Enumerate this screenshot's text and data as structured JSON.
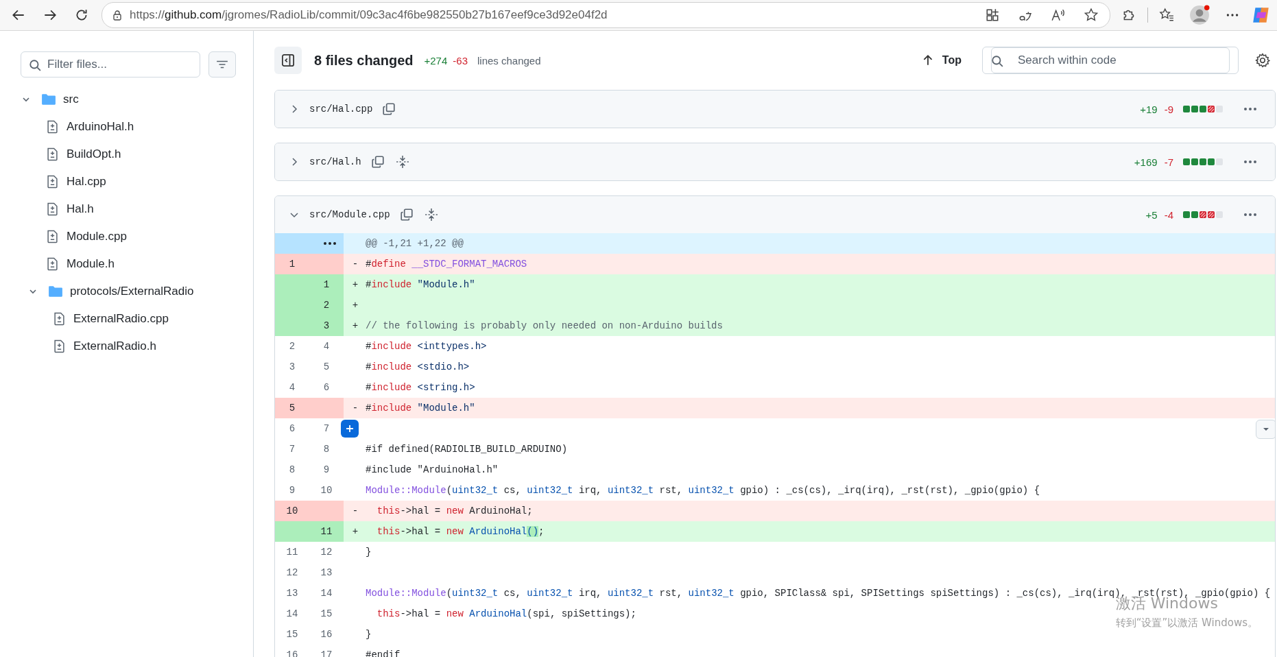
{
  "browser": {
    "url": {
      "scheme": "https://",
      "host": "github.com",
      "path": "/jgromes/RadioLib/commit/09c3ac4f6be982550b27b167eef9ce3d92e04f2d"
    }
  },
  "sidebar": {
    "filter": {
      "placeholder": "Filter files..."
    },
    "tree": [
      {
        "kind": "folder",
        "name": "src",
        "expanded": true,
        "children": [
          {
            "kind": "file",
            "name": "ArduinoHal.h"
          },
          {
            "kind": "file",
            "name": "BuildOpt.h"
          },
          {
            "kind": "file",
            "name": "Hal.cpp"
          },
          {
            "kind": "file",
            "name": "Hal.h"
          },
          {
            "kind": "file",
            "name": "Module.cpp"
          },
          {
            "kind": "file",
            "name": "Module.h"
          },
          {
            "kind": "folder",
            "name": "protocols/ExternalRadio",
            "expanded": true,
            "children": [
              {
                "kind": "file",
                "name": "ExternalRadio.cpp"
              },
              {
                "kind": "file",
                "name": "ExternalRadio.h"
              }
            ]
          }
        ]
      }
    ]
  },
  "summary": {
    "title": "8 files changed",
    "added": "+274",
    "deleted": "-63",
    "caption": "lines changed",
    "top_label": "Top",
    "search": {
      "placeholder": "Search within code"
    }
  },
  "files": [
    {
      "path": "src/Hal.cpp",
      "expanded": false,
      "expandable": false,
      "added": "+19",
      "deleted": "-9",
      "bar": [
        {
          "kind": "added"
        },
        {
          "kind": "added"
        },
        {
          "kind": "added"
        },
        {
          "kind": "deleted"
        },
        {
          "kind": "neutral"
        }
      ]
    },
    {
      "path": "src/Hal.h",
      "expanded": false,
      "expandable": true,
      "added": "+169",
      "deleted": "-7",
      "bar": [
        {
          "kind": "added"
        },
        {
          "kind": "added"
        },
        {
          "kind": "added"
        },
        {
          "kind": "added"
        },
        {
          "kind": "neutral"
        }
      ]
    },
    {
      "path": "src/Module.cpp",
      "expanded": true,
      "expandable": true,
      "added": "+5",
      "deleted": "-4",
      "bar": [
        {
          "kind": "added"
        },
        {
          "kind": "added"
        },
        {
          "kind": "deleted"
        },
        {
          "kind": "deleted"
        },
        {
          "kind": "neutral"
        }
      ],
      "lines": [
        {
          "kind": "hunk",
          "text": "@@ -1,21 +1,22 @@"
        },
        {
          "kind": "deleted",
          "old": "1",
          "sign": "-",
          "tokens": [
            {
              "text": "#",
              "kind": "plain"
            },
            {
              "text": "define",
              "kind": "keyword"
            },
            {
              "text": " __STDC_FORMAT_MACROS",
              "kind": "macro"
            }
          ]
        },
        {
          "kind": "added",
          "new": "1",
          "sign": "+",
          "tokens": [
            {
              "text": "#",
              "kind": "plain"
            },
            {
              "text": "include",
              "kind": "keyword"
            },
            {
              "text": " \"Module.h\"",
              "kind": "string"
            }
          ]
        },
        {
          "kind": "added",
          "new": "2",
          "sign": "+"
        },
        {
          "kind": "added",
          "new": "3",
          "sign": "+",
          "tokens": [
            {
              "text": "// the following is probably only needed on non-Arduino builds",
              "kind": "comment"
            }
          ]
        },
        {
          "kind": "context",
          "old": "2",
          "new": "4",
          "tokens": [
            {
              "text": "#",
              "kind": "plain"
            },
            {
              "text": "include",
              "kind": "keyword"
            },
            {
              "text": " <inttypes.h>",
              "kind": "string"
            }
          ]
        },
        {
          "kind": "context",
          "old": "3",
          "new": "5",
          "tokens": [
            {
              "text": "#",
              "kind": "plain"
            },
            {
              "text": "include",
              "kind": "keyword"
            },
            {
              "text": " <stdio.h>",
              "kind": "string"
            }
          ]
        },
        {
          "kind": "context",
          "old": "4",
          "new": "6",
          "tokens": [
            {
              "text": "#",
              "kind": "plain"
            },
            {
              "text": "include",
              "kind": "keyword"
            },
            {
              "text": " <string.h>",
              "kind": "string"
            }
          ]
        },
        {
          "kind": "deleted",
          "old": "5",
          "sign": "-",
          "tokens": [
            {
              "text": "#",
              "kind": "plain"
            },
            {
              "text": "include",
              "kind": "keyword"
            },
            {
              "text": " \"Module.h\"",
              "kind": "string"
            }
          ]
        },
        {
          "kind": "context",
          "old": "6",
          "new": "7",
          "hovered": true
        },
        {
          "kind": "context",
          "old": "7",
          "new": "8",
          "tokens": [
            {
              "text": "#if defined(RADIOLIB_BUILD_ARDUINO)",
              "kind": "plain"
            }
          ]
        },
        {
          "kind": "context",
          "old": "8",
          "new": "9",
          "tokens": [
            {
              "text": "#include \"ArduinoHal.h\"",
              "kind": "plain"
            }
          ]
        },
        {
          "kind": "context",
          "old": "9",
          "new": "10",
          "tokens": [
            {
              "text": "Module::Module",
              "kind": "macro"
            },
            {
              "text": "(",
              "kind": "plain"
            },
            {
              "text": "uint32_t",
              "kind": "type"
            },
            {
              "text": " cs, ",
              "kind": "plain"
            },
            {
              "text": "uint32_t",
              "kind": "type"
            },
            {
              "text": " irq, ",
              "kind": "plain"
            },
            {
              "text": "uint32_t",
              "kind": "type"
            },
            {
              "text": " rst, ",
              "kind": "plain"
            },
            {
              "text": "uint32_t",
              "kind": "type"
            },
            {
              "text": " gpio) : _cs(cs), _irq(irq), _rst(rst), _gpio(gpio) {",
              "kind": "plain"
            }
          ]
        },
        {
          "kind": "deleted",
          "old": "10",
          "sign": "-",
          "tokens": [
            {
              "text": "  this",
              "kind": "keyword"
            },
            {
              "text": "->hal = ",
              "kind": "plain"
            },
            {
              "text": "new",
              "kind": "keyword"
            },
            {
              "text": " ArduinoHal;",
              "kind": "plain"
            }
          ]
        },
        {
          "kind": "added",
          "new": "11",
          "sign": "+",
          "tokens": [
            {
              "text": "  this",
              "kind": "keyword"
            },
            {
              "text": "->hal = ",
              "kind": "plain"
            },
            {
              "text": "new",
              "kind": "keyword"
            },
            {
              "text": " ArduinoHal",
              "kind": "type"
            },
            {
              "text": "()",
              "kind": "changed"
            },
            {
              "text": ";",
              "kind": "plain"
            }
          ]
        },
        {
          "kind": "context",
          "old": "11",
          "new": "12",
          "tokens": [
            {
              "text": "}",
              "kind": "plain"
            }
          ]
        },
        {
          "kind": "context",
          "old": "12",
          "new": "13"
        },
        {
          "kind": "context",
          "old": "13",
          "new": "14",
          "tokens": [
            {
              "text": "Module::Module",
              "kind": "macro"
            },
            {
              "text": "(",
              "kind": "plain"
            },
            {
              "text": "uint32_t",
              "kind": "type"
            },
            {
              "text": " cs, ",
              "kind": "plain"
            },
            {
              "text": "uint32_t",
              "kind": "type"
            },
            {
              "text": " irq, ",
              "kind": "plain"
            },
            {
              "text": "uint32_t",
              "kind": "type"
            },
            {
              "text": " rst, ",
              "kind": "plain"
            },
            {
              "text": "uint32_t",
              "kind": "type"
            },
            {
              "text": " gpio, SPIClass& spi, SPISettings spiSettings) : _cs(cs), _irq(irq), _rst(rst), _gpio(gpio) {",
              "kind": "plain"
            }
          ]
        },
        {
          "kind": "context",
          "old": "14",
          "new": "15",
          "tokens": [
            {
              "text": "  this",
              "kind": "keyword"
            },
            {
              "text": "->hal = ",
              "kind": "plain"
            },
            {
              "text": "new",
              "kind": "keyword"
            },
            {
              "text": " ArduinoHal",
              "kind": "type"
            },
            {
              "text": "(spi, spiSettings);",
              "kind": "plain"
            }
          ]
        },
        {
          "kind": "context",
          "old": "15",
          "new": "16",
          "tokens": [
            {
              "text": "}",
              "kind": "plain"
            }
          ]
        },
        {
          "kind": "context",
          "old": "16",
          "new": "17",
          "tokens": [
            {
              "text": "#endif",
              "kind": "plain"
            }
          ]
        }
      ]
    }
  ],
  "os_notice": {
    "title": "激活 Windows",
    "hint": "转到“设置”以激活 Windows。"
  }
}
